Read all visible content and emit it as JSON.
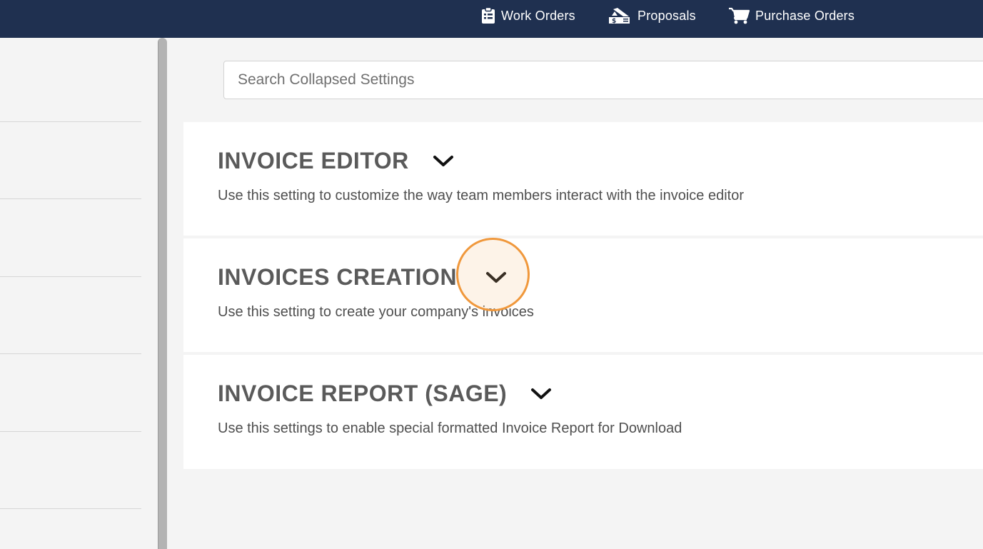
{
  "topnav": {
    "items": [
      {
        "label": "Work Orders",
        "icon": "clipboard-list-icon"
      },
      {
        "label": "Proposals",
        "icon": "proposal-dollar-icon"
      },
      {
        "label": "Purchase Orders",
        "icon": "shopping-cart-icon"
      }
    ]
  },
  "search": {
    "placeholder": "Search Collapsed Settings",
    "value": ""
  },
  "settings": [
    {
      "title": "INVOICE EDITOR",
      "description": "Use this setting to customize the way team members interact with the invoice editor",
      "icon": "chevron-down-icon"
    },
    {
      "title": "INVOICES CREATION",
      "description": "Use this setting to create your company's invoices",
      "icon": "chevron-down-icon"
    },
    {
      "title": "INVOICE REPORT (SAGE)",
      "description": "Use this settings to enable special formatted Invoice Report for Download",
      "icon": "chevron-down-icon"
    }
  ],
  "colors": {
    "topbar": "#1f3050",
    "highlight_ring": "#f0983c",
    "title_text": "#5a5a5a"
  }
}
